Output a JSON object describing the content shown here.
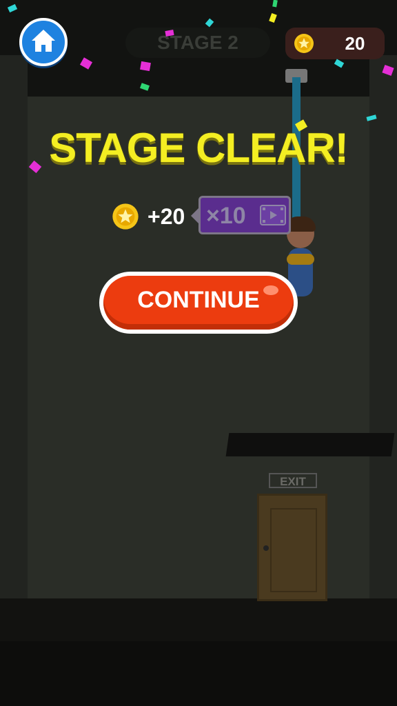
{
  "hud": {
    "stage_label": "STAGE 2",
    "coin_count": "20",
    "home_icon": "home-icon",
    "coin_icon": "coin-icon"
  },
  "result": {
    "title": "STAGE CLEAR!",
    "reward_amount": "+20",
    "multiplier_label": "×10",
    "video_icon": "video-play-icon",
    "continue_label": "CONTINUE"
  },
  "scene": {
    "exit_sign": "EXIT"
  },
  "colors": {
    "title_yellow": "#f4ee22",
    "continue_orange": "#ec3c0f",
    "home_blue": "#1e82e0",
    "multiplier_purple": "#5a2d8e",
    "coin_gold": "#f5c518"
  }
}
